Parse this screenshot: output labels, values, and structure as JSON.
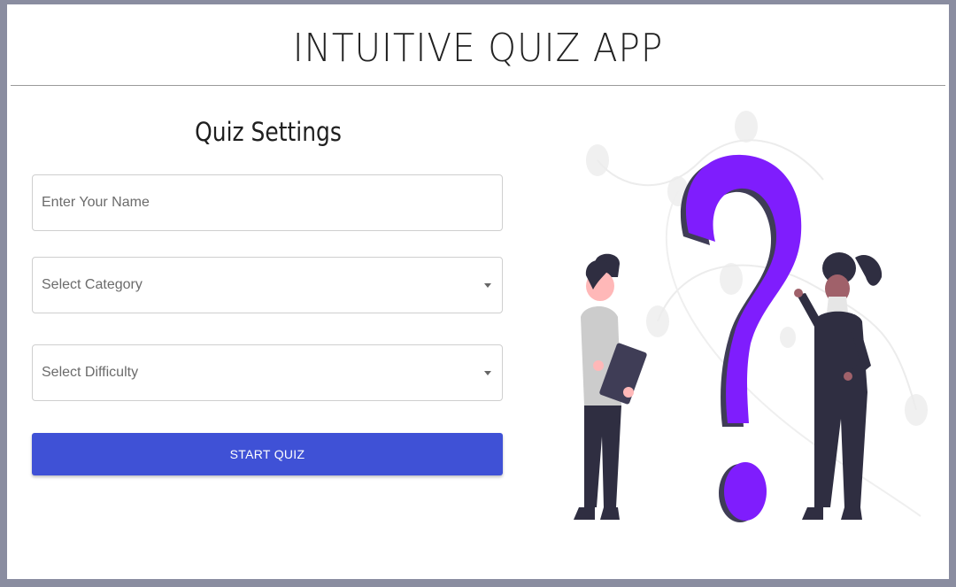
{
  "app": {
    "title": "INTUITIVE QUIZ APP"
  },
  "settings": {
    "title": "Quiz Settings",
    "name_field": {
      "placeholder": "Enter Your Name",
      "value": ""
    },
    "category_select": {
      "selected": "Select Category"
    },
    "difficulty_select": {
      "selected": "Select Difficulty"
    },
    "start_button_label": "START QUIZ"
  },
  "illustration": {
    "icon": "question-mark-people-illustration",
    "colors": {
      "accent": "#7f1dfd",
      "accent_shadow": "#3f3d56",
      "dark": "#2f2e41",
      "skin": "#ffb8b8",
      "skin_dark": "#a0616a",
      "shirt": "#cccccc",
      "blob": "#f0f0f0"
    }
  },
  "colors": {
    "frame": "#8a8da0",
    "button": "#3f51d6"
  }
}
